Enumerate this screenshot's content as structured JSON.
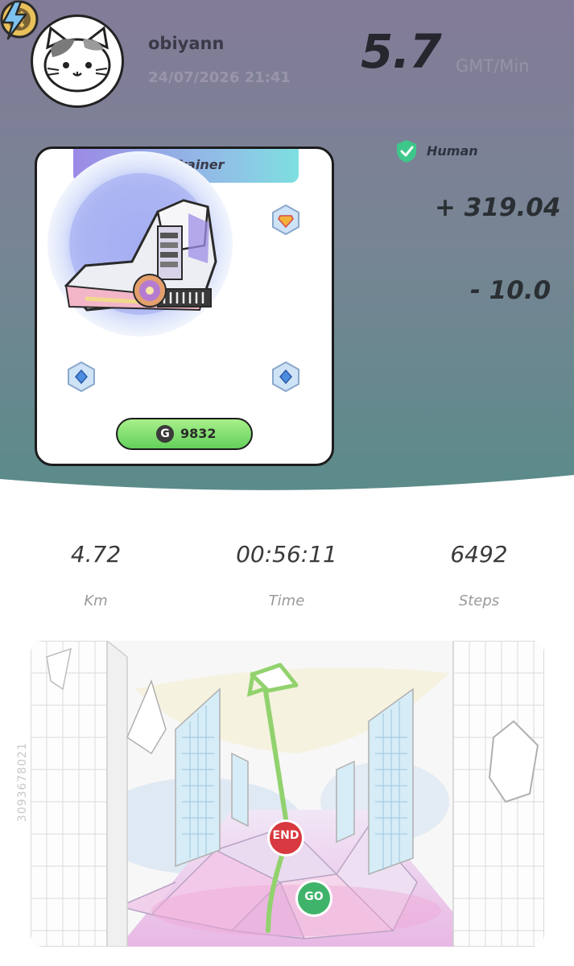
{
  "profile": {
    "username": "obiyann",
    "datetime": "24/07/2026 21:41"
  },
  "rate": {
    "value": "5.7",
    "unit": "GMT/Min"
  },
  "sneaker": {
    "type": "Trainer",
    "type_icon": "T",
    "points_icon": "G",
    "points": "9832"
  },
  "status": {
    "human_label": "Human",
    "earned": "+ 319.04",
    "energy": "- 10.0"
  },
  "stats": [
    {
      "value": "4.72",
      "label": "Km"
    },
    {
      "value": "00:56:11",
      "label": "Time"
    },
    {
      "value": "6492",
      "label": "Steps"
    }
  ],
  "map": {
    "end_label": "END",
    "go_label": "GO",
    "id_watermark": "3093678021"
  },
  "colors": {
    "header_top": "#837b98",
    "header_bottom": "#5b8b8a",
    "accent_green": "#7dd96a",
    "end_red": "#d8383f",
    "go_green": "#3fb36a"
  }
}
